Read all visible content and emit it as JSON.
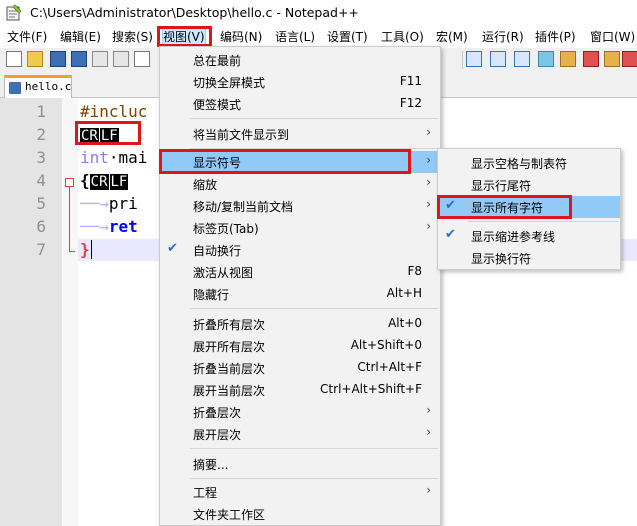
{
  "window": {
    "title": "C:\\Users\\Administrator\\Desktop\\hello.c - Notepad++"
  },
  "menubar": {
    "items": [
      "文件(F)",
      "编辑(E)",
      "搜索(S)",
      "视图(V)",
      "编码(N)",
      "语言(L)",
      "设置(T)",
      "工具(O)",
      "宏(M)",
      "运行(R)",
      "插件(P)",
      "窗口(W)"
    ],
    "open_item": "视图(V)"
  },
  "tabs": [
    {
      "label": "hello.c"
    }
  ],
  "editor": {
    "line_numbers": [
      "1",
      "2",
      "3",
      "4",
      "5",
      "6",
      "7"
    ],
    "lines": {
      "l1": "#incluc",
      "l3_kw": "int",
      "l3_rest": "·mai",
      "l4_brace": "{",
      "l5_arrow": "──→",
      "l5_text": "pri",
      "l6_arrow": "──→",
      "l6_text": "ret",
      "l7_brace": "}"
    },
    "eol_markers": {
      "cr": "CR",
      "lf": "LF"
    }
  },
  "view_menu": {
    "items": [
      {
        "label": "总在最前",
        "shortcut": ""
      },
      {
        "label": "切换全屏模式",
        "shortcut": "F11"
      },
      {
        "label": "便签模式",
        "shortcut": "F12"
      },
      {
        "label": "将当前文件显示到",
        "shortcut": ""
      },
      {
        "label": "显示符号",
        "shortcut": ""
      },
      {
        "label": "缩放",
        "shortcut": ""
      },
      {
        "label": "移动/复制当前文档",
        "shortcut": ""
      },
      {
        "label": "标签页(Tab)",
        "shortcut": ""
      },
      {
        "label": "自动换行",
        "shortcut": "",
        "checked": true
      },
      {
        "label": "激活从视图",
        "shortcut": "F8"
      },
      {
        "label": "隐藏行",
        "shortcut": "Alt+H"
      },
      {
        "label": "折叠所有层次",
        "shortcut": "Alt+0"
      },
      {
        "label": "展开所有层次",
        "shortcut": "Alt+Shift+0"
      },
      {
        "label": "折叠当前层次",
        "shortcut": "Ctrl+Alt+F"
      },
      {
        "label": "展开当前层次",
        "shortcut": "Ctrl+Alt+Shift+F"
      },
      {
        "label": "折叠层次",
        "shortcut": ""
      },
      {
        "label": "展开层次",
        "shortcut": ""
      },
      {
        "label": "摘要...",
        "shortcut": ""
      },
      {
        "label": "工程",
        "shortcut": ""
      },
      {
        "label": "文件夹工作区",
        "shortcut": ""
      }
    ]
  },
  "symbols_submenu": {
    "items": [
      {
        "label": "显示空格与制表符",
        "checked": false
      },
      {
        "label": "显示行尾符",
        "checked": false
      },
      {
        "label": "显示所有字符",
        "checked": true
      },
      {
        "label": "显示缩进参考线",
        "checked": true
      },
      {
        "label": "显示换行符",
        "checked": false
      }
    ]
  },
  "glyphs": {
    "check": "✔",
    "submenu_arrow": "›"
  },
  "colors": {
    "highlight": "#91c9f7",
    "annotation_red": "#e0141b",
    "check_blue": "#2b6cc4"
  }
}
